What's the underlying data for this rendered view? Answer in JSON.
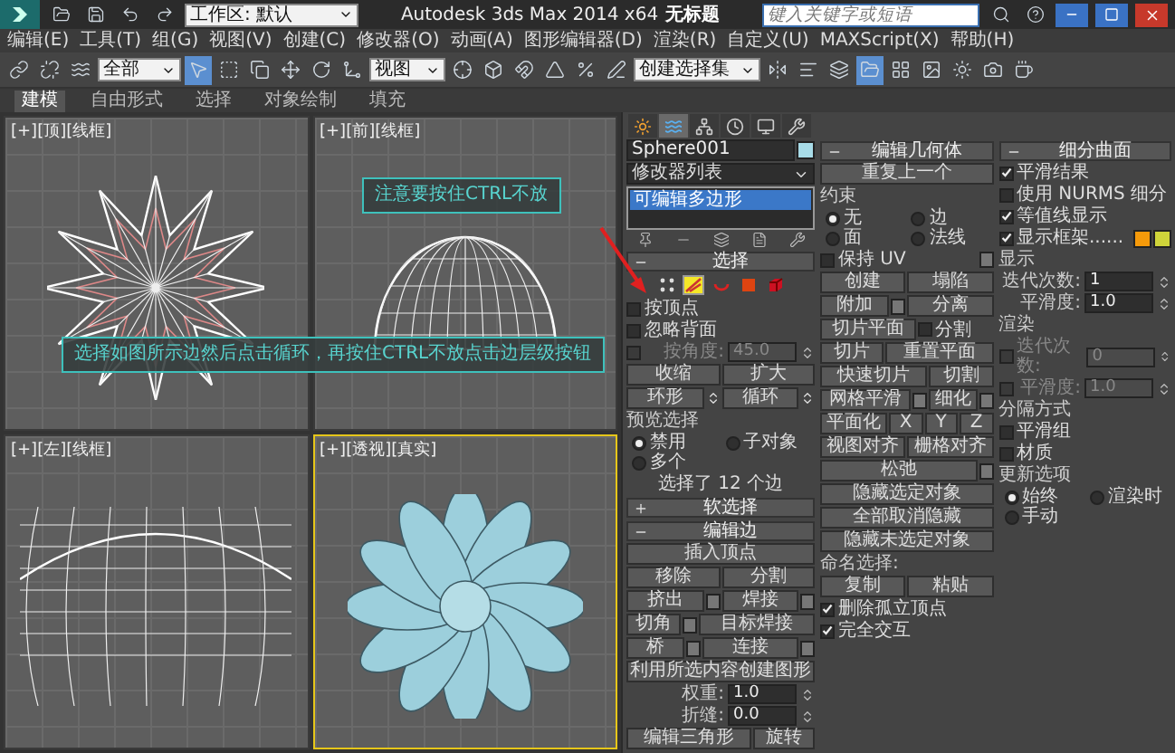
{
  "title_bar": {
    "workspace": "工作区: 默认",
    "app_title": "Autodesk 3ds Max  2014 x64",
    "document": "无标题",
    "search_placeholder": "键入关键字或短语"
  },
  "menu": [
    "编辑(E)",
    "工具(T)",
    "组(G)",
    "视图(V)",
    "创建(C)",
    "修改器(O)",
    "动画(A)",
    "图形编辑器(D)",
    "渲染(R)",
    "自定义(U)",
    "MAXScript(X)",
    "帮助(H)"
  ],
  "toolbar": {
    "filter": "全部",
    "coord": "视图",
    "selection_set": "创建选择集"
  },
  "ribbon": [
    {
      "label": "建模",
      "selected": true
    },
    {
      "label": "自由形式",
      "selected": false
    },
    {
      "label": "选择",
      "selected": false
    },
    {
      "label": "对象绘制",
      "selected": false
    },
    {
      "label": "填充",
      "selected": false
    }
  ],
  "viewports": [
    {
      "label": "[+][顶][线框]",
      "kind": "top",
      "active": false
    },
    {
      "label": "[+][前][线框]",
      "kind": "front",
      "active": false
    },
    {
      "label": "[+][左][线框]",
      "kind": "left",
      "active": false
    },
    {
      "label": "[+][透视][真实]",
      "kind": "perspective",
      "active": true
    }
  ],
  "command_panel": {
    "tabs": [
      {
        "kind": "create",
        "selected": false
      },
      {
        "kind": "modify",
        "selected": true
      },
      {
        "kind": "hierarchy",
        "selected": false
      },
      {
        "kind": "motion",
        "selected": false
      },
      {
        "kind": "display",
        "selected": false
      },
      {
        "kind": "utilities",
        "selected": false
      }
    ],
    "columns": [
      [
        {
          "kind": "field",
          "value": "Sphere001",
          "color": "#a8dce8"
        },
        {
          "kind": "dropdown",
          "value": "修改器列表"
        },
        {
          "kind": "stack",
          "items": [
            {
              "label": "可编辑多边形",
              "selected": true
            }
          ]
        },
        {
          "kind": "stack_toolbar"
        },
        {
          "kind": "rollout",
          "label": "选择",
          "expanded": true
        },
        {
          "kind": "subobjects",
          "items": [
            {
              "kind": "vertex",
              "selected": false
            },
            {
              "kind": "edge",
              "selected": true
            },
            {
              "kind": "border",
              "selected": false
            },
            {
              "kind": "polygon",
              "selected": false
            },
            {
              "kind": "element",
              "selected": false
            }
          ]
        },
        {
          "kind": "check",
          "label": "按顶点",
          "checked": false
        },
        {
          "kind": "check",
          "label": "忽略背面",
          "checked": false
        },
        {
          "kind": "spinner",
          "label": "按角度:",
          "value": "45.0",
          "checked": false,
          "disabled": true
        },
        {
          "kind": "buttons",
          "items": [
            {
              "label": "收缩"
            },
            {
              "label": "扩大"
            }
          ]
        },
        {
          "kind": "buttons",
          "items": [
            {
              "label": "环形",
              "spinner": true
            },
            {
              "label": "循环",
              "spinner": true
            }
          ]
        },
        {
          "kind": "group",
          "label": "预览选择"
        },
        {
          "kind": "radios",
          "items": [
            {
              "label": "禁用",
              "selected": true
            },
            {
              "label": "子对象",
              "selected": false
            },
            {
              "label": "多个",
              "selected": false
            }
          ]
        },
        {
          "kind": "text",
          "label": "选择了 12 个边"
        },
        {
          "kind": "rollout",
          "label": "软选择",
          "expanded": false
        },
        {
          "kind": "rollout",
          "label": "编辑边",
          "expanded": true
        },
        {
          "kind": "button",
          "label": "插入顶点"
        },
        {
          "kind": "buttons",
          "items": [
            {
              "label": "移除"
            },
            {
              "label": "分割"
            }
          ]
        },
        {
          "kind": "buttons",
          "items": [
            {
              "label": "挤出",
              "settings": true
            },
            {
              "label": "焊接",
              "settings": true
            }
          ]
        },
        {
          "kind": "buttons",
          "items": [
            {
              "label": "切角",
              "settings": true
            },
            {
              "label": "目标焊接"
            }
          ]
        },
        {
          "kind": "buttons",
          "items": [
            {
              "label": "桥",
              "settings": true
            },
            {
              "label": "连接",
              "settings": true
            }
          ]
        },
        {
          "kind": "button",
          "label": "利用所选内容创建图形"
        },
        {
          "kind": "spinner",
          "label": "权重:",
          "value": "1.0"
        },
        {
          "kind": "spinner",
          "label": "折缝:",
          "value": "0.0"
        },
        {
          "kind": "buttons",
          "items": [
            {
              "label": "编辑三角形"
            },
            {
              "label": "旋转"
            }
          ]
        }
      ],
      [
        {
          "kind": "rollout",
          "label": "编辑几何体",
          "expanded": true
        },
        {
          "kind": "button",
          "label": "重复上一个"
        },
        {
          "kind": "group",
          "label": "约束"
        },
        {
          "kind": "radios",
          "items": [
            {
              "label": "无",
              "selected": true
            },
            {
              "label": "边",
              "selected": false
            },
            {
              "label": "面",
              "selected": false
            },
            {
              "label": "法线",
              "selected": false
            }
          ]
        },
        {
          "kind": "check",
          "label": "保持 UV",
          "checked": false,
          "settings": true
        },
        {
          "kind": "buttons",
          "items": [
            {
              "label": "创建"
            },
            {
              "label": "塌陷"
            }
          ]
        },
        {
          "kind": "buttons",
          "items": [
            {
              "label": "附加",
              "settings": true
            },
            {
              "label": "分离"
            }
          ]
        },
        {
          "kind": "buttons",
          "items": [
            {
              "label": "切片平面"
            },
            {
              "label": "分割",
              "checked": false
            }
          ]
        },
        {
          "kind": "buttons",
          "items": [
            {
              "label": "切片"
            },
            {
              "label": "重置平面"
            }
          ]
        },
        {
          "kind": "buttons",
          "items": [
            {
              "label": "快速切片"
            },
            {
              "label": "切割"
            }
          ]
        },
        {
          "kind": "buttons",
          "items": [
            {
              "label": "网格平滑",
              "settings": true
            },
            {
              "label": "细化",
              "settings": true
            }
          ]
        },
        {
          "kind": "buttons",
          "items": [
            {
              "label": "平面化"
            },
            {
              "label": "X"
            },
            {
              "label": "Y"
            },
            {
              "label": "Z"
            }
          ]
        },
        {
          "kind": "buttons",
          "items": [
            {
              "label": "视图对齐"
            },
            {
              "label": "栅格对齐"
            }
          ]
        },
        {
          "kind": "buttons",
          "items": [
            {
              "label": "松弛",
              "settings": true
            }
          ]
        },
        {
          "kind": "button",
          "label": "隐藏选定对象"
        },
        {
          "kind": "button",
          "label": "全部取消隐藏"
        },
        {
          "kind": "button",
          "label": "隐藏未选定对象"
        },
        {
          "kind": "group",
          "label": "命名选择:"
        },
        {
          "kind": "buttons",
          "items": [
            {
              "label": "复制"
            },
            {
              "label": "粘贴"
            }
          ]
        },
        {
          "kind": "check",
          "label": "删除孤立顶点",
          "checked": true
        },
        {
          "kind": "check",
          "label": "完全交互",
          "checked": true
        }
      ],
      [
        {
          "kind": "rollout",
          "label": "细分曲面",
          "expanded": true
        },
        {
          "kind": "check",
          "label": "平滑结果",
          "checked": true
        },
        {
          "kind": "check",
          "label": "使用 NURMS 细分",
          "checked": false
        },
        {
          "kind": "check",
          "label": "等值线显示",
          "checked": true
        },
        {
          "kind": "check",
          "label": "显示框架......",
          "checked": true,
          "swatches": [
            {
              "color": "#f59a0a"
            },
            {
              "color": "#cfd43a"
            }
          ]
        },
        {
          "kind": "group",
          "label": "显示"
        },
        {
          "kind": "spinner",
          "label": "迭代次数:",
          "value": "1"
        },
        {
          "kind": "spinner",
          "label": "平滑度:",
          "value": "1.0"
        },
        {
          "kind": "group",
          "label": "渲染"
        },
        {
          "kind": "spinner",
          "label": "迭代次数:",
          "value": "0",
          "checked": false,
          "disabled": true
        },
        {
          "kind": "spinner",
          "label": "平滑度:",
          "value": "1.0",
          "checked": false,
          "disabled": true
        },
        {
          "kind": "group",
          "label": "分隔方式"
        },
        {
          "kind": "check",
          "label": "平滑组",
          "checked": false
        },
        {
          "kind": "check",
          "label": "材质",
          "checked": false
        },
        {
          "kind": "group",
          "label": "更新选项"
        },
        {
          "kind": "radios",
          "items": [
            {
              "label": "始终",
              "selected": true
            },
            {
              "label": "渲染时",
              "selected": false
            },
            {
              "label": "手动",
              "selected": false
            }
          ]
        }
      ]
    ]
  },
  "annotations": [
    {
      "text": "注意要按住CTRL不放"
    },
    {
      "text": "选择如图所示边然后点击循环，再按住CTRL不放点击边层级按钮"
    }
  ]
}
